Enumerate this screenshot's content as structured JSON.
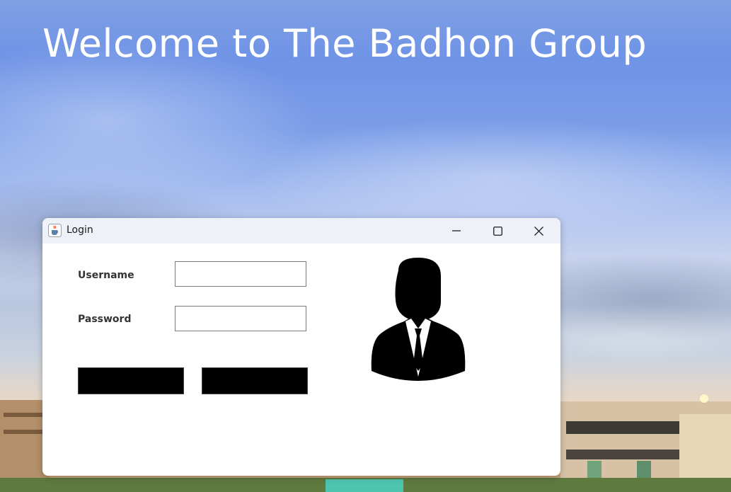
{
  "hero": {
    "title": "Welcome to The Badhon Group"
  },
  "window": {
    "title": "Login",
    "app_icon": "java-cup-icon",
    "controls": {
      "minimize_icon": "minimize-icon",
      "maximize_icon": "maximize-icon",
      "close_icon": "close-icon"
    }
  },
  "form": {
    "username_label": "Username",
    "password_label": "Password",
    "username_value": "",
    "password_value": "",
    "buttons": [
      {
        "label": ""
      },
      {
        "label": ""
      }
    ]
  },
  "illustration": {
    "icon": "user-businessman-icon"
  },
  "colors": {
    "title_text": "#ffffff",
    "window_bg": "#ffffff",
    "titlebar_bg": "#eef1f8",
    "button_fill": "#000000"
  }
}
